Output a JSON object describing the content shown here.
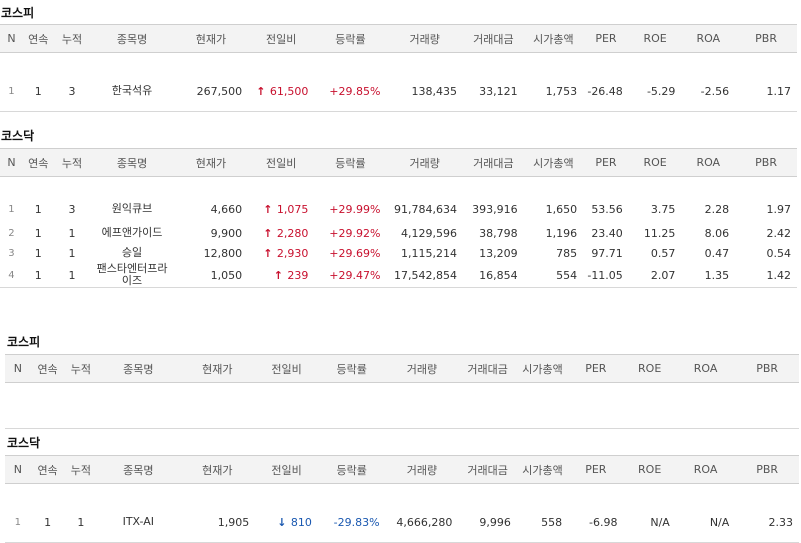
{
  "headers": [
    "N",
    "연속",
    "누적",
    "종목명",
    "현재가",
    "전일비",
    "등락률",
    "거래량",
    "거래대금",
    "시가총액",
    "PER",
    "ROE",
    "ROA",
    "PBR"
  ],
  "colors": {
    "up": "#c8102e",
    "down": "#1a58b0"
  },
  "sections": [
    {
      "title": "코스피",
      "rows": [
        {
          "n": "1",
          "streak": "1",
          "cum": "3",
          "name": "한국석유",
          "price": "267,500",
          "dir": "up",
          "arrow_icon": "arrow-up-icon",
          "change": "61,500",
          "rate": "+29.85%",
          "volume": "138,435",
          "amount": "33,121",
          "mcap": "1,753",
          "per": "-26.48",
          "roe": "-5.29",
          "roa": "-2.56",
          "pbr": "1.17"
        }
      ]
    },
    {
      "title": "코스닥",
      "rows": [
        {
          "n": "1",
          "streak": "1",
          "cum": "3",
          "name": "원익큐브",
          "price": "4,660",
          "dir": "up",
          "arrow_icon": "arrow-up-icon",
          "change": "1,075",
          "rate": "+29.99%",
          "volume": "91,784,634",
          "amount": "393,916",
          "mcap": "1,650",
          "per": "53.56",
          "roe": "3.75",
          "roa": "2.28",
          "pbr": "1.97"
        },
        {
          "n": "2",
          "streak": "1",
          "cum": "1",
          "name": "에프앤가이드",
          "price": "9,900",
          "dir": "up",
          "arrow_icon": "arrow-up-icon",
          "change": "2,280",
          "rate": "+29.92%",
          "volume": "4,129,596",
          "amount": "38,798",
          "mcap": "1,196",
          "per": "23.40",
          "roe": "11.25",
          "roa": "8.06",
          "pbr": "2.42"
        },
        {
          "n": "3",
          "streak": "1",
          "cum": "1",
          "name": "승일",
          "price": "12,800",
          "dir": "up",
          "arrow_icon": "arrow-up-icon",
          "change": "2,930",
          "rate": "+29.69%",
          "volume": "1,115,214",
          "amount": "13,209",
          "mcap": "785",
          "per": "97.71",
          "roe": "0.57",
          "roa": "0.47",
          "pbr": "0.54"
        },
        {
          "n": "4",
          "streak": "1",
          "cum": "1",
          "name": "팬스타엔터프라이즈",
          "price": "1,050",
          "dir": "up",
          "arrow_icon": "arrow-up-icon",
          "change": "239",
          "rate": "+29.47%",
          "volume": "17,542,854",
          "amount": "16,854",
          "mcap": "554",
          "per": "-11.05",
          "roe": "2.07",
          "roa": "1.35",
          "pbr": "1.42"
        }
      ]
    },
    {
      "title": "코스피",
      "rows": []
    },
    {
      "title": "코스닥",
      "rows": [
        {
          "n": "1",
          "streak": "1",
          "cum": "1",
          "name": "ITX-AI",
          "price": "1,905",
          "dir": "down",
          "arrow_icon": "arrow-down-icon",
          "change": "810",
          "rate": "-29.83%",
          "volume": "4,666,280",
          "amount": "9,996",
          "mcap": "558",
          "per": "-6.98",
          "roe": "N/A",
          "roa": "N/A",
          "pbr": "2.33"
        }
      ]
    }
  ]
}
